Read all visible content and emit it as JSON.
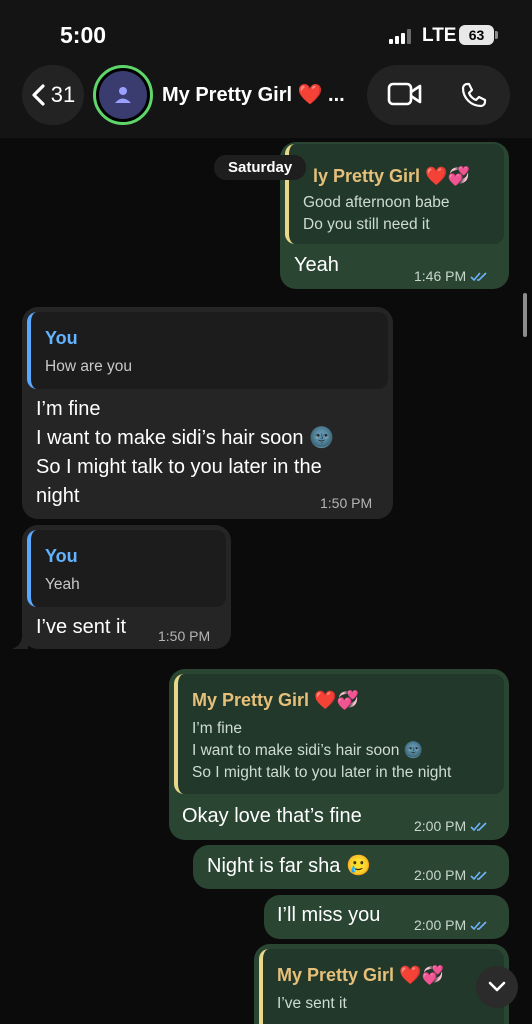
{
  "status": {
    "time": "5:00",
    "network": "LTE",
    "battery": "63"
  },
  "header": {
    "back_count": "31",
    "contact_name": "My Pretty Girl ❤️ ..."
  },
  "chat": {
    "day_label": "Saturday",
    "messages": [
      {
        "dir": "out",
        "quote_author": "My Pretty Girl ❤️💞",
        "quote_author_visible": "ly Pretty Girl ❤️💞",
        "quote_text": "Good afternoon babe\nDo you still need it",
        "text": "Yeah",
        "time": "1:46 PM"
      },
      {
        "dir": "in",
        "quote_author": "You",
        "quote_text": "How are you",
        "text": "I’m fine\nI want to make sidi’s hair soon 🌚\nSo I might talk to you later in the\nnight",
        "time": "1:50 PM"
      },
      {
        "dir": "in",
        "quote_author": "You",
        "quote_text": "Yeah",
        "text": "I’ve sent it",
        "time": "1:50 PM"
      },
      {
        "dir": "out",
        "quote_author": "My Pretty Girl ❤️💞",
        "quote_text": "I’m fine\nI want to make sidi’s hair soon 🌚\nSo I might talk to you later in the night",
        "text": "Okay love that’s fine",
        "time": "2:00 PM"
      },
      {
        "dir": "out",
        "text": "Night is far sha 🥲",
        "time": "2:00 PM"
      },
      {
        "dir": "out",
        "text": "I’ll miss you",
        "time": "2:00 PM"
      },
      {
        "dir": "out",
        "quote_author": "My Pretty Girl ❤️💞",
        "quote_text": "I’ve sent it"
      }
    ]
  },
  "colors": {
    "incoming_bubble": "#252525",
    "outgoing_bubble": "#2a4633",
    "quote_you": "#63b3ff",
    "quote_her": "#e6c07a",
    "read_ticks": "#6fb3ff"
  },
  "icons": [
    "chevron-left-icon",
    "person-icon",
    "video-camera-icon",
    "phone-icon",
    "double-check-icon",
    "chevron-down-icon"
  ]
}
